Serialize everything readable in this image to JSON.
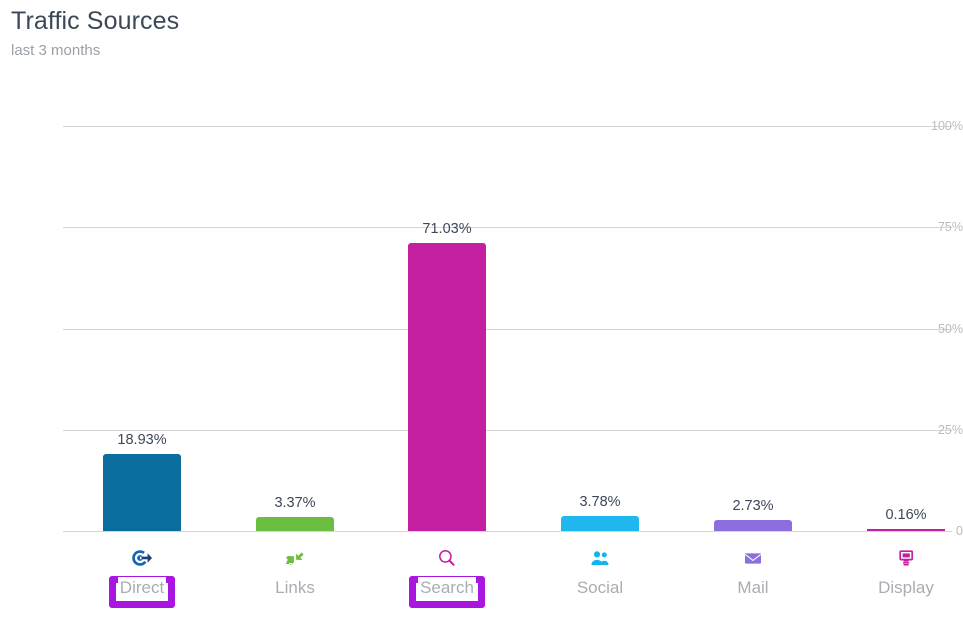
{
  "header": {
    "title": "Traffic Sources",
    "subtitle": "last 3 months"
  },
  "colors": {
    "title": "#3c4858",
    "subtitle": "#9aa0a6",
    "gridline": "#d5d5d5",
    "tick": "#b9bcc0",
    "category_label": "#a9adb2",
    "highlight": "#a916e0",
    "direct": "#0a6d9e",
    "links": "#6cbe41",
    "search": "#c41fa0",
    "social": "#20b7ee",
    "mail": "#8c6ede",
    "display": "#c41fa0"
  },
  "chart_data": {
    "type": "bar",
    "title": "Traffic Sources",
    "subtitle": "last 3 months",
    "xlabel": "",
    "ylabel": "",
    "ylim": [
      0,
      100
    ],
    "grid": true,
    "legend": "none",
    "ytick_labels": [
      "100%",
      "75%",
      "50%",
      "25%",
      "0"
    ],
    "ytick_values": [
      100,
      75,
      50,
      25,
      0
    ],
    "categories": [
      "Direct",
      "Links",
      "Search",
      "Social",
      "Mail",
      "Display"
    ],
    "values": [
      18.93,
      3.37,
      71.03,
      3.78,
      2.73,
      0.16
    ],
    "value_labels": [
      "18.93%",
      "3.37%",
      "71.03%",
      "3.78%",
      "2.73%",
      "0.16%"
    ],
    "colors": [
      "#0a6d9e",
      "#6cbe41",
      "#c41fa0",
      "#20b7ee",
      "#8c6ede",
      "#c41fa0"
    ],
    "icons": [
      "target-icon",
      "link-arrows-icon",
      "magnifier-icon",
      "people-icon",
      "envelope-icon",
      "display-ad-icon"
    ],
    "highlighted": [
      "Direct",
      "Search"
    ]
  }
}
